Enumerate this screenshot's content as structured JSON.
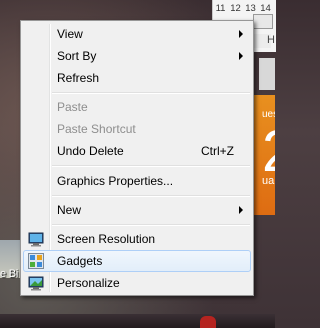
{
  "desktop": {
    "calendar_numbers": [
      "11",
      "12",
      "13",
      "14"
    ],
    "calendar_row2": "H",
    "date_gadget_day": "ues",
    "date_gadget_number": "2",
    "date_gadget_month": "uar",
    "icon_label": "e Bi"
  },
  "menu": {
    "items": [
      {
        "label": "View",
        "submenu": true
      },
      {
        "label": "Sort By",
        "submenu": true
      },
      {
        "label": "Refresh"
      },
      {
        "label": "Paste",
        "disabled": true
      },
      {
        "label": "Paste Shortcut",
        "disabled": true
      },
      {
        "label": "Undo Delete",
        "shortcut": "Ctrl+Z"
      },
      {
        "label": "Graphics Properties..."
      },
      {
        "label": "New",
        "submenu": true
      },
      {
        "label": "Screen Resolution",
        "icon": "screen-resolution-icon"
      },
      {
        "label": "Gadgets",
        "icon": "gadgets-icon",
        "highlighted": true
      },
      {
        "label": "Personalize",
        "icon": "personalize-icon"
      }
    ]
  },
  "colors": {
    "highlight_border": "#aecff7",
    "menu_background": "#f0f0f0",
    "date_gadget": "#e8901f"
  }
}
